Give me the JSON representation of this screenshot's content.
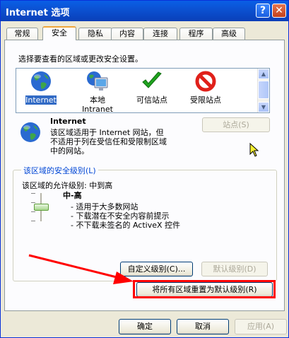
{
  "window": {
    "title": "Internet 选项",
    "help_glyph": "?",
    "close_glyph": "✕"
  },
  "tabs": [
    {
      "label": "常规"
    },
    {
      "label": "安全"
    },
    {
      "label": "隐私"
    },
    {
      "label": "内容"
    },
    {
      "label": "连接"
    },
    {
      "label": "程序"
    },
    {
      "label": "高级"
    }
  ],
  "security": {
    "instruction": "选择要查看的区域或更改安全设置。",
    "zones": [
      {
        "label": "Internet",
        "icon": "globe-icon",
        "selected": true
      },
      {
        "label": "本地\nIntranet",
        "icon": "intranet-computer-icon"
      },
      {
        "label": "可信站点",
        "icon": "checkmark-icon"
      },
      {
        "label": "受限站点",
        "icon": "restricted-icon"
      }
    ],
    "zone_desc_title": "Internet",
    "zone_desc_lines": [
      "该区域适用于 Internet 网站，但",
      "不适用于列在受信任和受限制区域",
      "中的网站。"
    ],
    "sites_button": "站点(S)",
    "level_group_label": "该区域的安全级别(L)",
    "allowed_levels": "该区域的允许级别: 中到高",
    "level_name": "中-高",
    "level_bullets": [
      "- 适用于大多数网站",
      "- 下载潜在不安全内容前提示",
      "- 不下载未签名的 ActiveX 控件"
    ],
    "custom_level_button": "自定义级别(C)...",
    "default_level_button": "默认级别(D)",
    "reset_all_button": "将所有区域重置为默认级别(R)"
  },
  "footer": {
    "ok": "确定",
    "cancel": "取消",
    "apply": "应用(A)"
  },
  "annotation_color": "#ff0000"
}
